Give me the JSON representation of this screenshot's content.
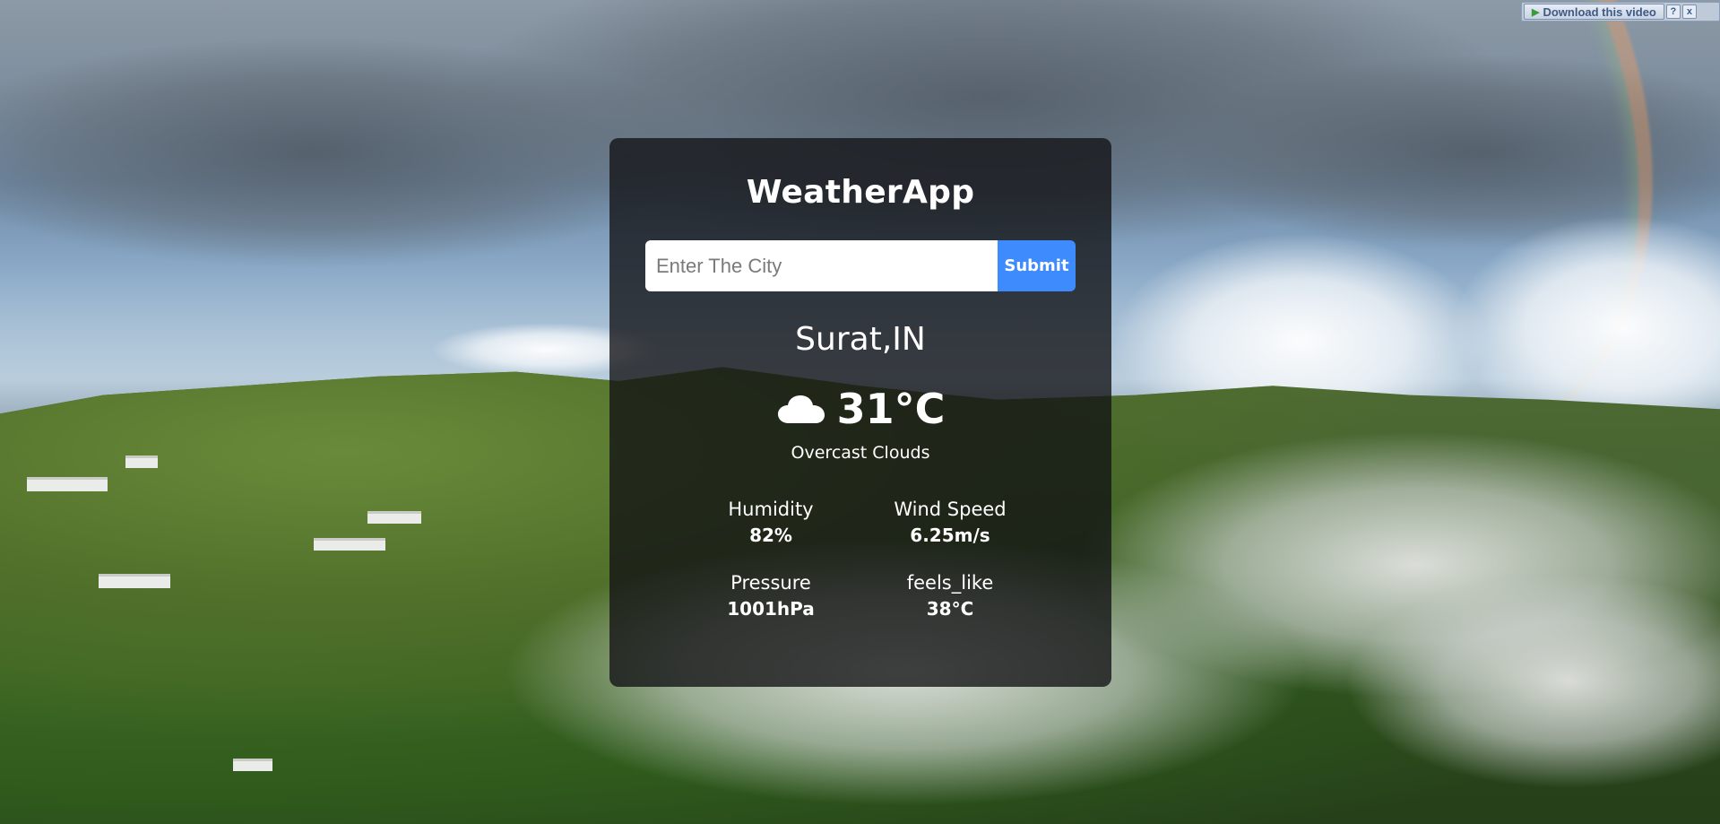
{
  "extension_bar": {
    "download_label": "Download this video",
    "help_label": "?",
    "close_label": "x"
  },
  "app": {
    "title": "WeatherApp"
  },
  "search": {
    "placeholder": "Enter The City",
    "value": "",
    "submit_label": "Submit"
  },
  "weather": {
    "city": "Surat,IN",
    "icon": "cloud-icon",
    "temperature": "31°C",
    "condition": "Overcast Clouds"
  },
  "stats": {
    "humidity_label": "Humidity",
    "humidity_value": "82%",
    "wind_label": "Wind Speed",
    "wind_value": "6.25m/s",
    "pressure_label": "Pressure",
    "pressure_value": "1001hPa",
    "feels_label": "feels_like",
    "feels_value": "38°C"
  },
  "colors": {
    "accent": "#3d8bfd",
    "card_bg": "#121214",
    "text": "#ffffff"
  }
}
